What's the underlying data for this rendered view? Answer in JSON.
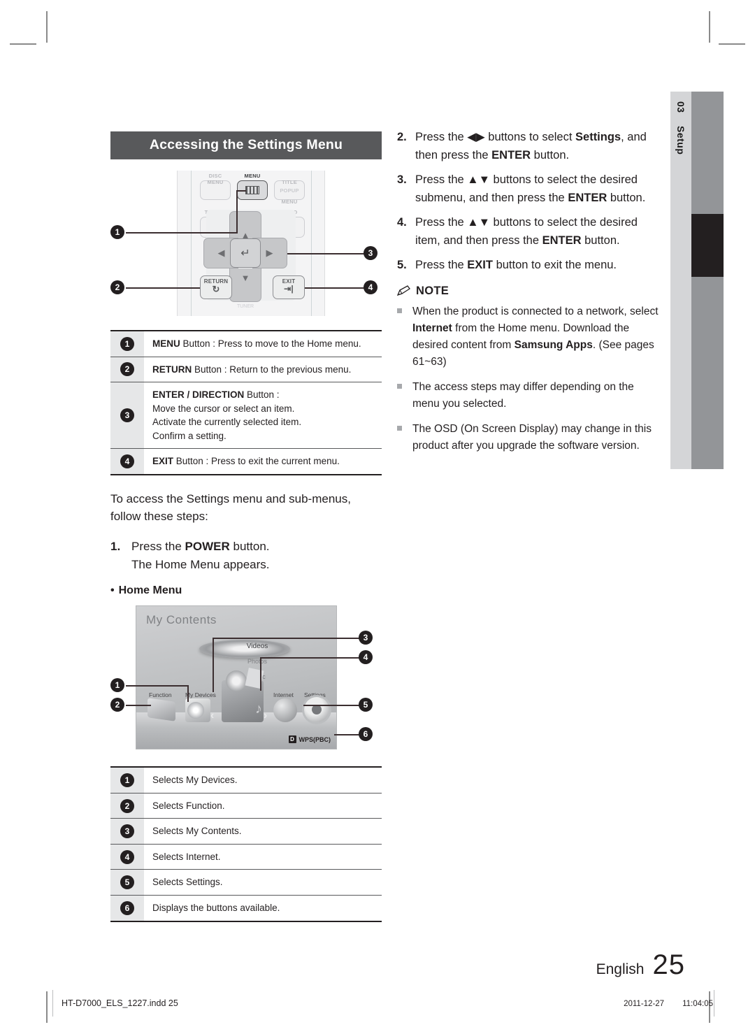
{
  "crop_marks": true,
  "chapter_tab": {
    "number": "03",
    "label": "Setup"
  },
  "left": {
    "section_title": "Accessing the Settings Menu",
    "remote": {
      "buttons": [
        {
          "name": "disc-menu",
          "label": "DISC MENU",
          "sub": ""
        },
        {
          "name": "menu",
          "label": "MENU",
          "sub": ""
        },
        {
          "name": "title-menu",
          "label": "TITLE MENU",
          "sub": "POPUP"
        },
        {
          "name": "tools",
          "label": "TOOLS",
          "sub": ""
        },
        {
          "name": "info",
          "label": "INFO",
          "sub": ""
        },
        {
          "name": "return",
          "label": "RETURN",
          "sub": ""
        },
        {
          "name": "exit",
          "label": "EXIT",
          "sub": ""
        }
      ],
      "tuner_label": "TUNER",
      "callouts": [
        "1",
        "2",
        "3",
        "4"
      ]
    },
    "button_table": [
      {
        "num": "1",
        "lines": [
          {
            "bold": "MENU",
            "rest": " Button : Press to move to the Home menu."
          }
        ]
      },
      {
        "num": "2",
        "lines": [
          {
            "bold": "RETURN",
            "rest": " Button : Return to the previous menu."
          }
        ]
      },
      {
        "num": "3",
        "lines": [
          {
            "bold": "ENTER / DIRECTION",
            "rest": " Button :"
          },
          {
            "bold": "",
            "rest": "Move the cursor or select an item."
          },
          {
            "bold": "",
            "rest": "Activate the currently selected item."
          },
          {
            "bold": "",
            "rest": "Confirm a setting."
          }
        ]
      },
      {
        "num": "4",
        "lines": [
          {
            "bold": "EXIT",
            "rest": " Button : Press to exit the current menu."
          }
        ]
      }
    ],
    "intro": "To access the Settings menu and sub-menus, follow these steps:",
    "step1": {
      "num": "1.",
      "pre": "Press the ",
      "bold": "POWER",
      "post": " button.",
      "second": "The Home Menu appears."
    },
    "home_menu_heading": "Home Menu",
    "home_menu": {
      "title": "My Contents",
      "carousel": [
        "Videos",
        "Photos",
        "Music"
      ],
      "icons": [
        "Function",
        "My Devices",
        "Internet",
        "Settings"
      ],
      "wps_key": "D",
      "wps_label": "WPS(PBC)",
      "left_arrow": "‹",
      "right_arrow": "›",
      "callouts": [
        "1",
        "2",
        "3",
        "4",
        "5",
        "6"
      ]
    },
    "menu_table": [
      {
        "num": "1",
        "text": "Selects My Devices."
      },
      {
        "num": "2",
        "text": "Selects Function."
      },
      {
        "num": "3",
        "text": "Selects My Contents."
      },
      {
        "num": "4",
        "text": "Selects Internet."
      },
      {
        "num": "5",
        "text": "Selects Settings."
      },
      {
        "num": "6",
        "text": "Displays the buttons available."
      }
    ]
  },
  "right": {
    "steps": [
      {
        "num": "2.",
        "parts": [
          {
            "t": "Press the "
          },
          {
            "t": "◀▶",
            "arrow": true
          },
          {
            "t": " buttons to select "
          },
          {
            "t": "Settings",
            "b": true
          },
          {
            "t": ", and then press the "
          },
          {
            "t": "ENTER",
            "b": true
          },
          {
            "t": " button."
          }
        ]
      },
      {
        "num": "3.",
        "parts": [
          {
            "t": "Press the "
          },
          {
            "t": "▲▼",
            "arrow": true
          },
          {
            "t": " buttons to select the desired submenu, and then press the "
          },
          {
            "t": "ENTER",
            "b": true
          },
          {
            "t": " button."
          }
        ]
      },
      {
        "num": "4.",
        "parts": [
          {
            "t": "Press the "
          },
          {
            "t": "▲▼",
            "arrow": true
          },
          {
            "t": " buttons to select the desired item, and then press the "
          },
          {
            "t": "ENTER",
            "b": true
          },
          {
            "t": " button."
          }
        ]
      },
      {
        "num": "5.",
        "parts": [
          {
            "t": "Press the "
          },
          {
            "t": "EXIT",
            "b": true
          },
          {
            "t": " button to exit the menu."
          }
        ]
      }
    ],
    "note_title": "NOTE",
    "notes": [
      [
        {
          "t": "When the product is connected to a network, select "
        },
        {
          "t": "Internet",
          "b": true
        },
        {
          "t": " from the Home menu. Download the desired content from "
        },
        {
          "t": "Samsung Apps",
          "b": true
        },
        {
          "t": ". (See pages 61~63)"
        }
      ],
      [
        {
          "t": "The access steps may differ depending on the menu you selected."
        }
      ],
      [
        {
          "t": "The OSD (On Screen Display) may change in this product after you upgrade the software version."
        }
      ]
    ]
  },
  "footer": {
    "language": "English",
    "page_number": "25",
    "file_name": "HT-D7000_ELS_1227.indd   25",
    "date": "2011-12-27",
    "time": "11:04:05"
  },
  "colors": {
    "section_header_bg": "#58595b",
    "chapter_tab_bg": "#d4d5d7",
    "chapter_bar_bg": "#939598",
    "chapter_active": "#231f20",
    "text": "#231f20"
  }
}
